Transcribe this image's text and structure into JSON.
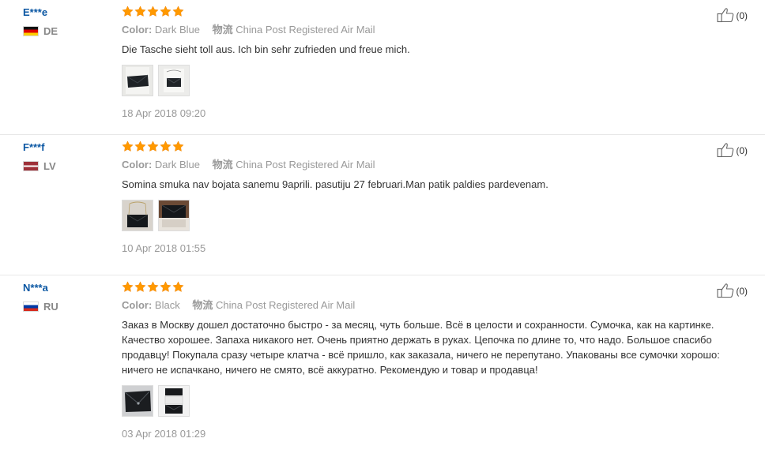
{
  "reviews": [
    {
      "user_name": "E***e",
      "country": "DE",
      "flag_colors": [
        "#111111",
        "#dd0000",
        "#ffce00"
      ],
      "stars": 5,
      "color_label": "Color:",
      "color_value": "Dark Blue",
      "shipping_label": "物流",
      "shipping_value": "China Post Registered Air Mail",
      "text": "Die Tasche sieht toll aus. Ich bin sehr zufrieden und freue mich.",
      "photos": [
        "bag-photo",
        "bag-photo"
      ],
      "date": "18 Apr 2018 09:20",
      "helpful_count": "(0)"
    },
    {
      "user_name": "F***f",
      "country": "LV",
      "flag_colors": [
        "#9e3039",
        "#ffffff"
      ],
      "stars": 5,
      "color_label": "Color:",
      "color_value": "Dark Blue",
      "shipping_label": "物流",
      "shipping_value": "China Post Registered Air Mail",
      "text": "Somina smuka nav bojata sanemu 9aprili. pasutiju 27 februari.Man patik paldies pardevenam.",
      "photos": [
        "bag-photo",
        "bag-photo"
      ],
      "date": "10 Apr 2018 01:55",
      "helpful_count": "(0)"
    },
    {
      "user_name": "N***a",
      "country": "RU",
      "flag_colors": [
        "#ffffff",
        "#0039a6",
        "#d52b1e"
      ],
      "stars": 5,
      "color_label": "Color:",
      "color_value": "Black",
      "shipping_label": "物流",
      "shipping_value": "China Post Registered Air Mail",
      "text": "Заказ в Москву дошел достаточно быстро - за месяц, чуть больше. Всё в целости и сохранности. Сумочка, как на картинке. Качество хорошее. Запаха никакого нет. Очень приятно держать в руках. Цепочка по длине то, что надо. Большое спасибо продавцу! Покупала сразу четыре клатча - всё пришло, как заказала, ничего не перепутано. Упакованы все сумочки хорошо: ничего не испачкано, ничего не смято, всё аккуратно. Рекомендую и товар и продавца!",
      "photos": [
        "bag-photo",
        "bag-photo"
      ],
      "date": "03 Apr 2018 01:29",
      "helpful_count": "(0)"
    }
  ],
  "colors": {
    "username": "#0b57a3",
    "star": "#ff9900",
    "meta_text": "#999999",
    "body_text": "#333333"
  },
  "icons": {
    "star": "star-icon",
    "helpful": "thumbs-up-icon"
  }
}
